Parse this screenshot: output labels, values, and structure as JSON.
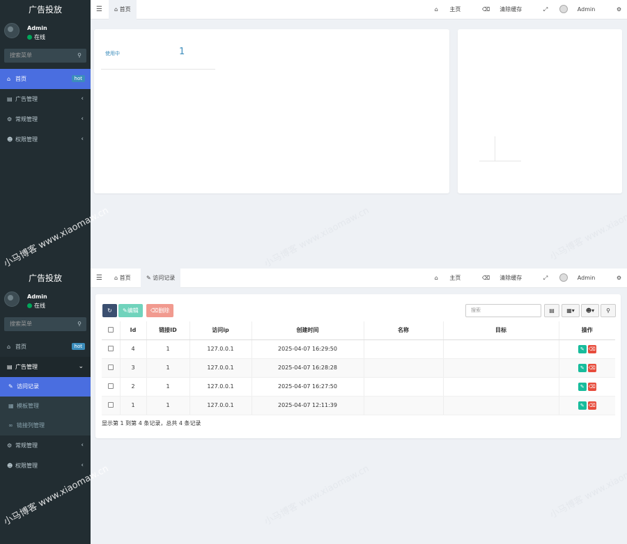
{
  "sidebar": {
    "brand": "广告投放",
    "user_name": "Admin",
    "user_status": "在线",
    "search_placeholder": "搜索菜单",
    "menu": {
      "home": "首页",
      "home_badge": "hot",
      "ads": "广告管理",
      "general": "常规管理",
      "perm": "权限管理"
    },
    "ads_submenu": {
      "visits": "访问记录",
      "templates": "模板管理",
      "links": "链接列管理"
    }
  },
  "header": {
    "tab_home": "首页",
    "tab_visits": "访问记录",
    "nav_home": "主页",
    "nav_clear_cache": "清除缓存",
    "nav_user": "Admin"
  },
  "dashboard": {
    "stat_label": "使用中",
    "stat_value": "1"
  },
  "toolbar": {
    "edit_label": "编辑",
    "delete_label": "删除",
    "search_placeholder": "搜索"
  },
  "table": {
    "headers": [
      "Id",
      "链接ID",
      "访问ip",
      "创建时间",
      "名称",
      "目标",
      "操作"
    ],
    "rows": [
      {
        "id": "4",
        "link_id": "1",
        "ip": "127.0.0.1",
        "created": "2025-04-07 16:29:50"
      },
      {
        "id": "3",
        "link_id": "1",
        "ip": "127.0.0.1",
        "created": "2025-04-07 16:28:28"
      },
      {
        "id": "2",
        "link_id": "1",
        "ip": "127.0.0.1",
        "created": "2025-04-07 16:27:50"
      },
      {
        "id": "1",
        "link_id": "1",
        "ip": "127.0.0.1",
        "created": "2025-04-07 12:11:39"
      }
    ],
    "summary": "显示第 1 到第 4 条记录，总共 4 条记录"
  },
  "watermark": "小马博客 www.xiaomaw.cn",
  "colors": {
    "sidebar_bg": "#222d32",
    "active_blue": "#4a6ee0",
    "edit_green": "#18bc9c",
    "delete_red": "#e74c3c"
  }
}
